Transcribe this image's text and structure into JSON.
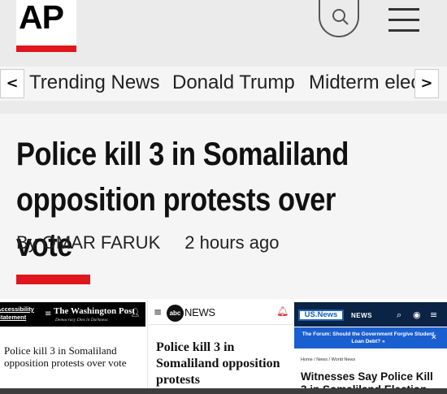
{
  "ap": {
    "logo": "AP",
    "trending": {
      "prev_arrow": "<",
      "next_arrow": ">",
      "items": [
        "Trending News",
        "Donald Trump",
        "Midterm elec"
      ]
    },
    "article": {
      "headline": "Police kill 3 in Somaliland opposition protests over vote",
      "byline": "By OMAR FARUK",
      "timestamp": "2 hours ago"
    },
    "colors": {
      "brand_red": "#e0161d",
      "background": "#ebebeb"
    }
  },
  "washington_post": {
    "accessibility_link": "Accessibility Statement",
    "logo": "The Washington Post",
    "tagline": "Democracy Dies in Darkness",
    "headline": "Police kill 3 in Somaliland opposition protests over vote",
    "icons": [
      "menu-icon",
      "user-icon"
    ]
  },
  "abc": {
    "logo_mark": "abc",
    "logo_word": "NEWS",
    "headline": "Police kill 3 in Somaliland opposition protests",
    "icons": [
      "menu-icon",
      "bell-icon"
    ]
  },
  "usnews": {
    "logo": "US.News",
    "section": "NEWS",
    "banner": "The Forum: Should the Government Forgive Student Loan Debt? »",
    "breadcrumb": "Home  /  News  /  World News",
    "headline_line1": "Witnesses Say Police Kill",
    "headline_line2": "3 in Somaliland Election",
    "icons": [
      "search-icon",
      "user-icon",
      "menu-icon",
      "close-icon"
    ],
    "colors": {
      "navy": "#0b2345",
      "banner_blue": "#1a5fd0"
    }
  }
}
